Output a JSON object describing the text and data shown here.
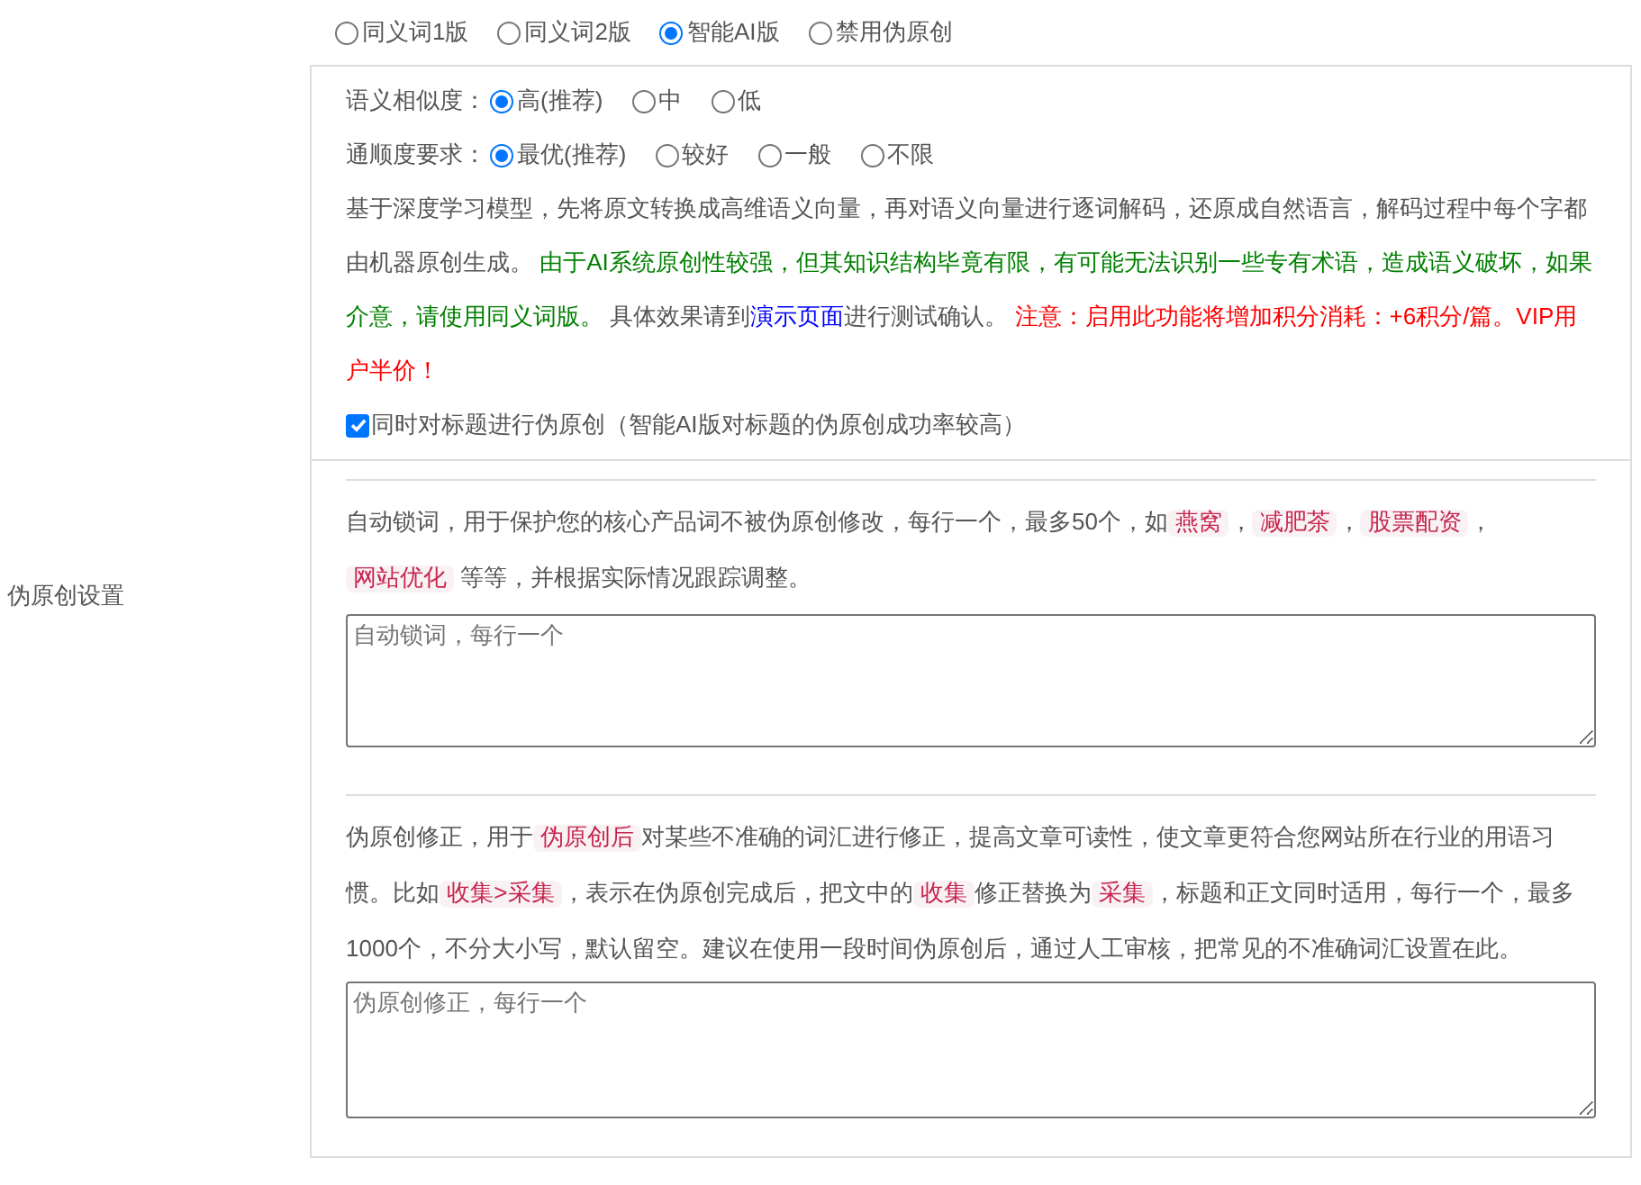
{
  "section_label": "伪原创设置",
  "modes": [
    {
      "label": "同义词1版",
      "selected": false
    },
    {
      "label": "同义词2版",
      "selected": false
    },
    {
      "label": "智能AI版",
      "selected": true
    },
    {
      "label": "禁用伪原创",
      "selected": false
    }
  ],
  "ai_settings": {
    "options": [
      {
        "label": "语义相似度：",
        "choices": [
          {
            "label": "高(推荐)",
            "selected": true
          },
          {
            "label": "中",
            "selected": false
          },
          {
            "label": "低",
            "selected": false
          }
        ]
      },
      {
        "label": "通顺度要求：",
        "choices": [
          {
            "label": "最优(推荐)",
            "selected": true
          },
          {
            "label": "较好",
            "selected": false
          },
          {
            "label": "一般",
            "selected": false
          },
          {
            "label": "不限",
            "selected": false
          }
        ]
      }
    ],
    "description": [
      {
        "kind": "plain",
        "text": "基于深度学习模型，先将原文转换成高维语义向量，再对语义向量进行逐词解码，还原成自然语言，解码过程中每个字都由机器原创生成。 "
      },
      {
        "kind": "notice",
        "text": "由于AI系统原创性较强，但其知识结构毕竟有限，有可能无法识别一些专有术语，造成语义破坏，如果介意，请使用同义词版。"
      },
      {
        "kind": "plain",
        "text": " 具体效果请到"
      },
      {
        "kind": "link",
        "text": "演示页面"
      },
      {
        "kind": "plain",
        "text": "进行测试确认。 "
      },
      {
        "kind": "warning",
        "text": "注意：启用此功能将增加积分消耗：+6积分/篇。VIP用户半价！"
      }
    ],
    "title_rewrite": {
      "label": "同时对标题进行伪原创（智能AI版对标题的伪原创成功率较高）",
      "checked": true
    }
  },
  "lock_words": {
    "description": [
      {
        "kind": "plain",
        "text": "自动锁词，用于保护您的核心产品词不被伪原创修改，每行一个，最多50个，如"
      },
      {
        "kind": "tag",
        "text": "燕窝"
      },
      {
        "kind": "plain",
        "text": "，"
      },
      {
        "kind": "tag",
        "text": "减肥茶"
      },
      {
        "kind": "plain",
        "text": "，"
      },
      {
        "kind": "tag",
        "text": "股票配资"
      },
      {
        "kind": "plain",
        "text": "，"
      },
      {
        "kind": "tag",
        "text": "网站优化"
      },
      {
        "kind": "plain",
        "text": " 等等，并根据实际情况跟踪调整。"
      }
    ],
    "placeholder": "自动锁词，每行一个"
  },
  "corrections": {
    "description": [
      {
        "kind": "plain",
        "text": "伪原创修正，用于"
      },
      {
        "kind": "tag",
        "text": "伪原创后"
      },
      {
        "kind": "plain",
        "text": "对某些不准确的词汇进行修正，提高文章可读性，使文章更符合您网站所在行业的用语习惯。比如"
      },
      {
        "kind": "tag",
        "text": "收集>采集"
      },
      {
        "kind": "plain",
        "text": "，表示在伪原创完成后，把文中的"
      },
      {
        "kind": "tag",
        "text": "收集"
      },
      {
        "kind": "plain",
        "text": "修正替换为"
      },
      {
        "kind": "tag",
        "text": "采集"
      },
      {
        "kind": "plain",
        "text": "，标题和正文同时适用，每行一个，最多1000个，不分大小写，默认留空。建议在使用一段时间伪原创后，通过人工审核，把常见的不准确词汇设置在此。"
      }
    ],
    "placeholder": "伪原创修正，每行一个"
  }
}
